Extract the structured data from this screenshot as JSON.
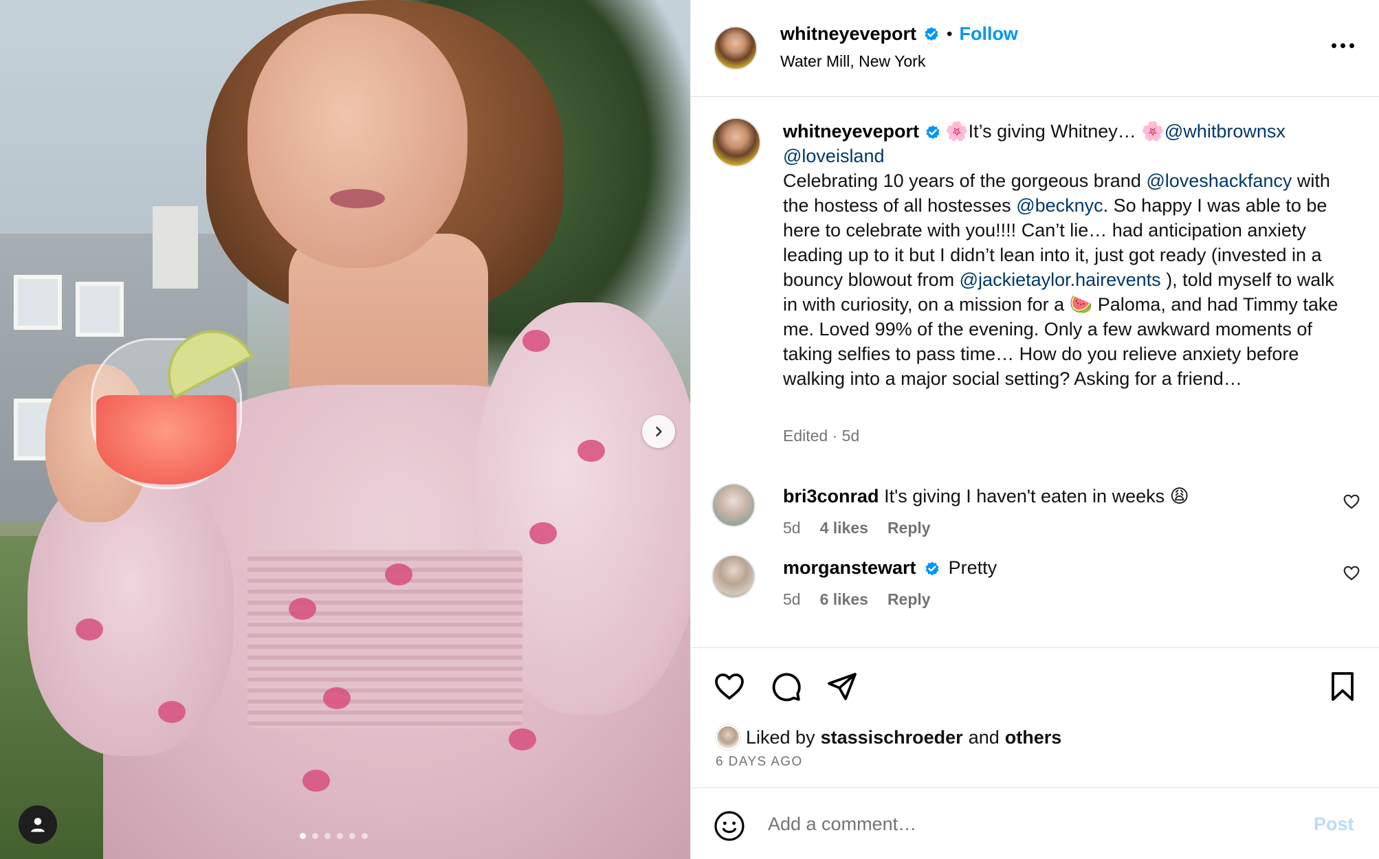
{
  "post": {
    "username": "whitneyeveport",
    "follow_label": "Follow",
    "separator": "•",
    "location": "Water Mill, New York",
    "more_icon": "more-horizontal-icon"
  },
  "caption": {
    "username": "whitneyeveport",
    "seg1": "🌸It’s giving Whitney… 🌸",
    "mention1": "@whitbrownsx",
    "mention2": "@loveisland",
    "seg2": "Celebrating 10 years of the gorgeous brand ",
    "mention3": "@loveshackfancy",
    "seg3": " with the hostess of all hostesses ",
    "mention4": "@becknyc",
    "seg4": ". So happy I was able to be here to celebrate with you!!!! Can’t lie… had anticipation anxiety leading up to it but I didn’t lean into it, just got ready (invested in a bouncy blowout from ",
    "mention5": "@jackietaylor.hairevents",
    "seg5": " ), told myself to walk in with curiosity, on a mission for a 🍉 Paloma, and had Timmy take me. Loved 99% of the evening. Only a few awkward moments of taking selfies to pass time… How do you relieve anxiety before walking into a major social setting? Asking for a friend…",
    "meta": "Edited · 5d"
  },
  "comments": [
    {
      "username": "bri3conrad",
      "verified": false,
      "text": "It's giving I haven't eaten in weeks 😩",
      "time": "5d",
      "likes": "4 likes",
      "reply": "Reply"
    },
    {
      "username": "morganstewart",
      "verified": true,
      "text": "Pretty",
      "time": "5d",
      "likes": "6 likes",
      "reply": "Reply"
    }
  ],
  "actions": {
    "icons": [
      "heart-icon",
      "comment-icon",
      "share-icon",
      "bookmark-icon"
    ],
    "liked_prefix": "Liked by",
    "liked_user": "stassischroeder",
    "liked_and": "and",
    "liked_others": "others",
    "time_ago": "6 DAYS AGO"
  },
  "add_comment": {
    "placeholder": "Add a comment…",
    "post_label": "Post"
  },
  "carousel": {
    "slide_count": 6,
    "active_index": 0
  },
  "colors": {
    "link_blue": "#0095f6",
    "mention": "#00376b",
    "secondary_text": "#737373",
    "post_disabled": "#b8dcfb"
  }
}
